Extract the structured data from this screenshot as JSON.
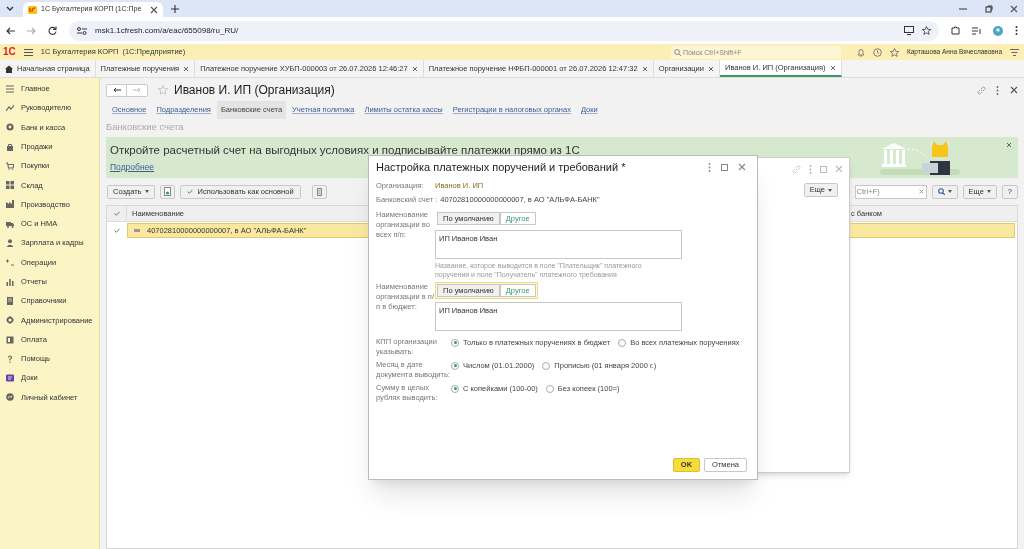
{
  "browser": {
    "tab_title": "1С Бухгалтерия КОРП (1С:Пре",
    "url": "msk1.1cfresh.com/a/eac/655098/ru_RU/"
  },
  "app_header": {
    "logo": "1С",
    "title": "1С Бухгалтерия КОРП",
    "subtitle": "(1С:Предприятие)",
    "search_placeholder": "Поиск Ctrl+Shift+F",
    "user": "Карташова Анна Вячеславовна"
  },
  "open_tabs": [
    {
      "label": "Начальная страница",
      "kind": "home",
      "selected": false
    },
    {
      "label": "Платежные поручения",
      "kind": "page",
      "selected": false
    },
    {
      "label": "Платежное поручение ХУБП-000003 от 26.07.2026 12:46:27",
      "kind": "page",
      "selected": false
    },
    {
      "label": "Платежное поручение НФБП-000001 от 26.07.2026 12:47:32",
      "kind": "page",
      "selected": false
    },
    {
      "label": "Организации",
      "kind": "page",
      "selected": false
    },
    {
      "label": "Иванов И. ИП (Организация)",
      "kind": "page",
      "selected": true
    }
  ],
  "sidebar": {
    "items": [
      {
        "label": "Главное"
      },
      {
        "label": "Руководителю"
      },
      {
        "label": "Банк и касса"
      },
      {
        "label": "Продажи"
      },
      {
        "label": "Покупки"
      },
      {
        "label": "Склад"
      },
      {
        "label": "Производство"
      },
      {
        "label": "ОС и НМА"
      },
      {
        "label": "Зарплата и кадры"
      },
      {
        "label": "Операции"
      },
      {
        "label": "Отчеты"
      },
      {
        "label": "Справочники"
      },
      {
        "label": "Администрирование"
      },
      {
        "label": "Оплата"
      },
      {
        "label": "Помощь"
      },
      {
        "label": "Доки"
      },
      {
        "label": "Личный кабинет"
      }
    ]
  },
  "form": {
    "title": "Иванов И. ИП (Организация)",
    "links": [
      {
        "label": "Основное",
        "selected": false
      },
      {
        "label": "Подразделения",
        "selected": false
      },
      {
        "label": "Банковские счета",
        "selected": true
      },
      {
        "label": "Учетная политика",
        "selected": false
      },
      {
        "label": "Лимиты остатка кассы",
        "selected": false
      },
      {
        "label": "Регистрации в налоговых органах",
        "selected": false
      },
      {
        "label": "Доки",
        "selected": false
      }
    ],
    "section_title": "Банковские счета",
    "banner": {
      "text": "Откройте расчетный счет на выгодных условиях и подписывайте платежки прямо из 1С",
      "link": "Подробнее"
    },
    "toolbar": {
      "create": "Создать",
      "use_main": "Использовать как основной",
      "search_hint": "Ctrl+F)",
      "more": "Еще",
      "help": "?"
    },
    "table": {
      "columns": [
        "Наименование",
        "с банком"
      ],
      "rows": [
        {
          "name": "40702810000000000007, в АО \"АЛЬФА-БАНК\"",
          "main": true,
          "selected": true
        }
      ]
    }
  },
  "background_window": {
    "more": "Еще"
  },
  "dialog": {
    "title": "Настройка платежных поручений и требований *",
    "organization": {
      "label": "Организация:",
      "value": "Иванов И. ИП"
    },
    "account": {
      "label": "Банковский счет :",
      "value": "40702810000000000007, в АО \"АЛЬФА-БАНК\""
    },
    "name_blocks": [
      {
        "label": "Наименование организации во всех п/п:",
        "focused": false,
        "options": [
          {
            "label": "По умолчанию",
            "selected": false
          },
          {
            "label": "Другое",
            "selected": true
          }
        ],
        "value": "ИП Иванов Иван",
        "hint": "Название, которое выводится в поле \"Плательщик\" платежного поручения и поле \"Получатель\" платежного требования"
      },
      {
        "label": "Наименование организации в п/п в бюджет:",
        "focused": true,
        "options": [
          {
            "label": "По умолчанию",
            "selected": false
          },
          {
            "label": "Другое",
            "selected": true
          }
        ],
        "value": "ИП Иванов Иван"
      }
    ],
    "radio_groups": [
      {
        "label": "КПП организации указывать:",
        "options": [
          {
            "label": "Только в платежных поручениях в бюджет",
            "selected": true
          },
          {
            "label": "Во всех платежных поручениях",
            "selected": false
          }
        ]
      },
      {
        "label": "Месяц в дате документа выводить:",
        "options": [
          {
            "label": "Числом (01.01.2000)",
            "selected": true
          },
          {
            "label": "Прописью (01 января 2000 г.)",
            "selected": false
          }
        ]
      },
      {
        "label": "Сумму в целых рублях выводить:",
        "options": [
          {
            "label": "С копейками (100-00)",
            "selected": true
          },
          {
            "label": "Без копеек (100=)",
            "selected": false
          }
        ]
      }
    ],
    "buttons": [
      {
        "label": "OK",
        "default": true
      },
      {
        "label": "Отмена",
        "default": false
      }
    ]
  }
}
